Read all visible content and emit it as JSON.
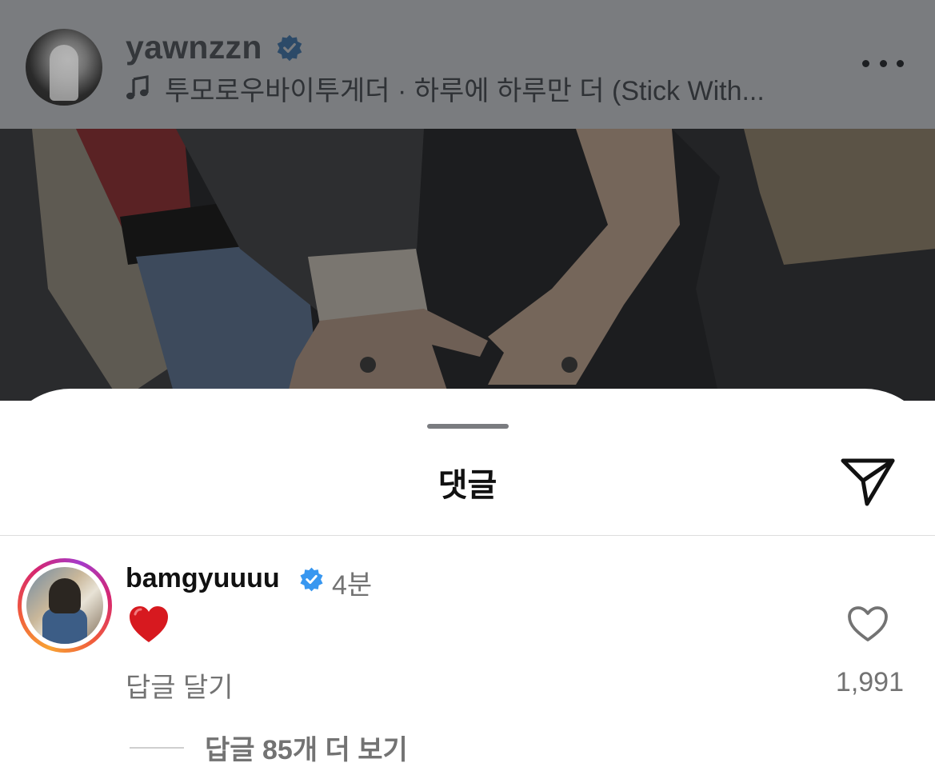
{
  "post": {
    "username": "yawnzzn",
    "music": "투모로우바이투게더 · 하루에 하루만 더 (Stick With..."
  },
  "sheet": {
    "title": "댓글"
  },
  "comment": {
    "username": "bamgyuuuu",
    "time": "4분",
    "body_emoji": "red-heart",
    "reply_label": "답글 달기",
    "like_count": "1,991",
    "view_replies_label": "답글 85개 더 보기"
  },
  "icons": {
    "verified": "verified-badge-icon",
    "music": "music-note-icon",
    "more": "more-horizontal-icon",
    "share": "paper-plane-icon",
    "like": "heart-outline-icon"
  },
  "colors": {
    "verified_blue": "#0095f6",
    "secondary_text": "#737373",
    "story_ring": [
      "#f7a233",
      "#d6266f",
      "#a43bcb"
    ]
  }
}
